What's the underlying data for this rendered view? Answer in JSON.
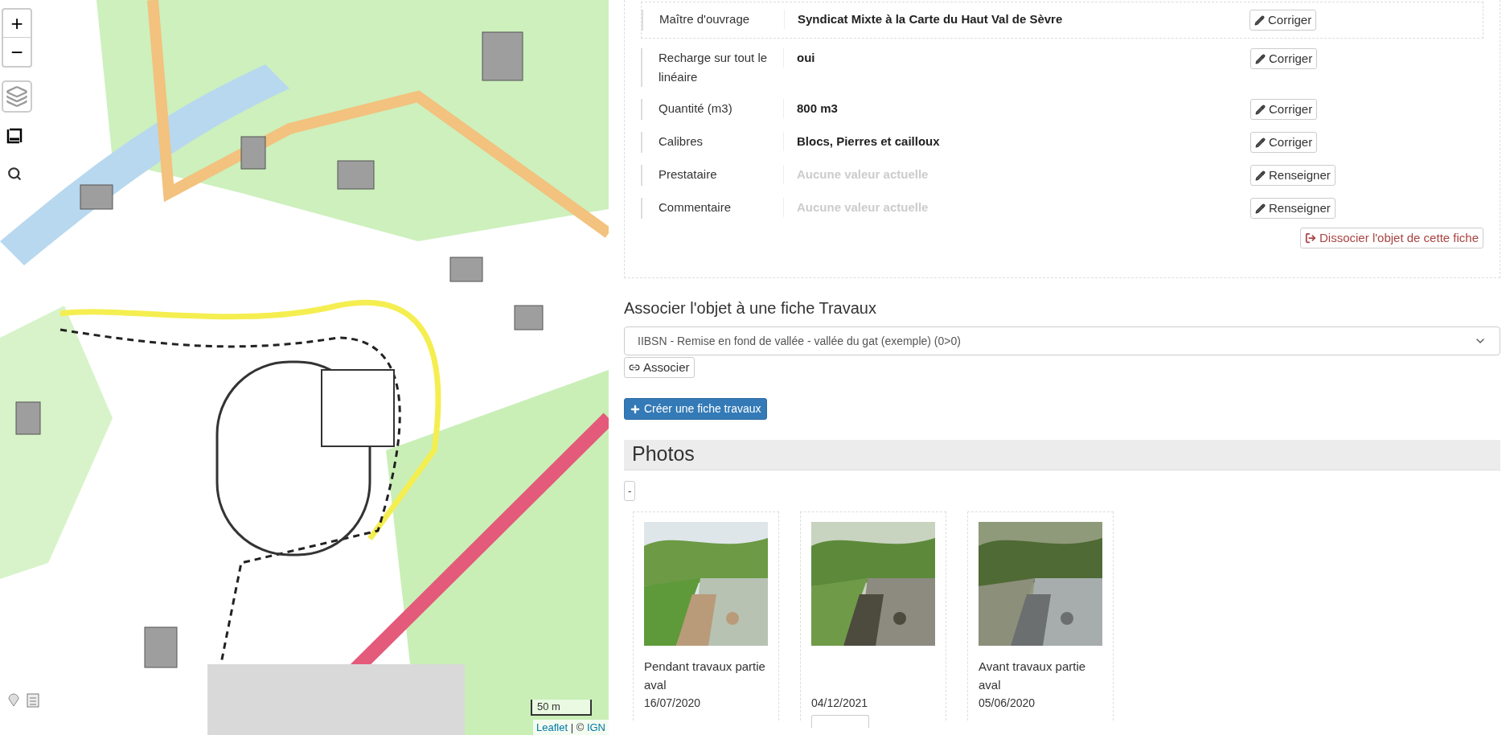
{
  "map": {
    "zoom_controls": [
      "+",
      "−"
    ],
    "scale": "50 m",
    "attribution": {
      "link": "Leaflet",
      "separator": " | © ",
      "provider": "IGN"
    }
  },
  "fields": [
    {
      "label": "Maître d'ouvrage",
      "value": "Syndicat Mixte à la Carte du Haut Val de Sèvre",
      "empty": false,
      "highlighted": true,
      "action": "Corriger"
    },
    {
      "label": "Recharge sur tout le linéaire",
      "value": "oui",
      "empty": false,
      "highlighted": false,
      "action": "Corriger"
    },
    {
      "label": "Quantité (m3)",
      "value": "800 m3",
      "empty": false,
      "highlighted": false,
      "action": "Corriger"
    },
    {
      "label": "Calibres",
      "value": "Blocs, Pierres et cailloux",
      "empty": false,
      "highlighted": false,
      "action": "Corriger"
    },
    {
      "label": "Prestataire",
      "value": "Aucune valeur actuelle",
      "empty": true,
      "highlighted": false,
      "action": "Renseigner"
    },
    {
      "label": "Commentaire",
      "value": "Aucune valeur actuelle",
      "empty": true,
      "highlighted": false,
      "action": "Renseigner"
    }
  ],
  "dissociate_button": "Dissocier l'objet de cette fiche",
  "associate": {
    "title": "Associer l'objet à une fiche Travaux",
    "select_value": "IIBSN - Remise en fond de vallée - vallée du gat (exemple) (0>0)",
    "button": "Associer"
  },
  "create_button": "Créer une fiche travaux",
  "photos": {
    "title": "Photos",
    "toggle": "-",
    "items": [
      {
        "caption": "Pendant travaux partie aval",
        "date": "16/07/2020",
        "kind": "picture"
      },
      {
        "date": "04/12/2021",
        "kind": "picture"
      },
      {
        "caption": "Avant travaux partie aval",
        "date": "05/06/2020",
        "kind": "picture"
      }
    ]
  }
}
